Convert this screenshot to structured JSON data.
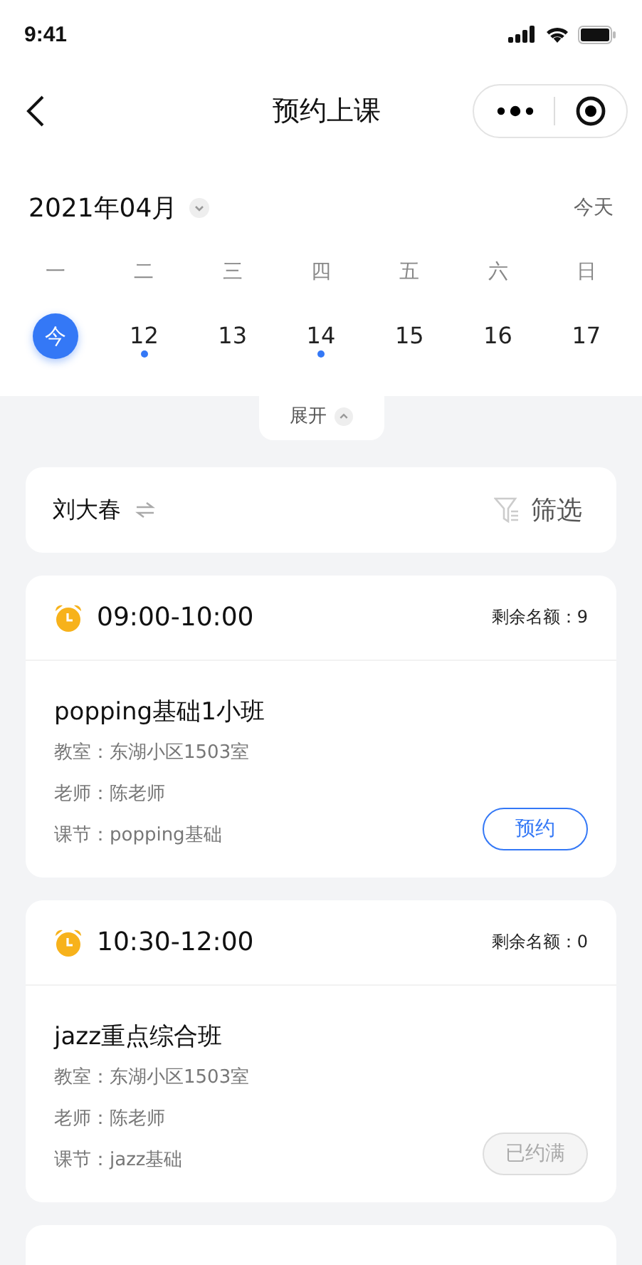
{
  "status_bar": {
    "time": "9:41"
  },
  "nav": {
    "title": "预约上课"
  },
  "calendar": {
    "month": "2021年04月",
    "today_button": "今天",
    "weekdays": [
      "一",
      "二",
      "三",
      "四",
      "五",
      "六",
      "日"
    ],
    "days": [
      {
        "label": "今",
        "selected": true,
        "has_event": false
      },
      {
        "label": "12",
        "selected": false,
        "has_event": true
      },
      {
        "label": "13",
        "selected": false,
        "has_event": false
      },
      {
        "label": "14",
        "selected": false,
        "has_event": true
      },
      {
        "label": "15",
        "selected": false,
        "has_event": false
      },
      {
        "label": "16",
        "selected": false,
        "has_event": false
      },
      {
        "label": "17",
        "selected": false,
        "has_event": false
      }
    ],
    "expand": "展开"
  },
  "student": {
    "name": "刘大春",
    "filter": "筛选"
  },
  "sessions": [
    {
      "time": "09:00-10:00",
      "kind": "quota",
      "right": "剩余名额：9",
      "title": "popping基础1小班",
      "details": [
        "教室：东湖小区1503室",
        "老师：陈老师",
        "课节：popping基础"
      ],
      "button": "预约",
      "disabled": false
    },
    {
      "time": "10:30-12:00",
      "kind": "quota",
      "right": "剩余名额：0",
      "title": "jazz重点综合班",
      "details": [
        "教室：东湖小区1503室",
        "老师：陈老师",
        "课节：jazz基础"
      ],
      "button": "已约满",
      "disabled": true
    }
  ]
}
